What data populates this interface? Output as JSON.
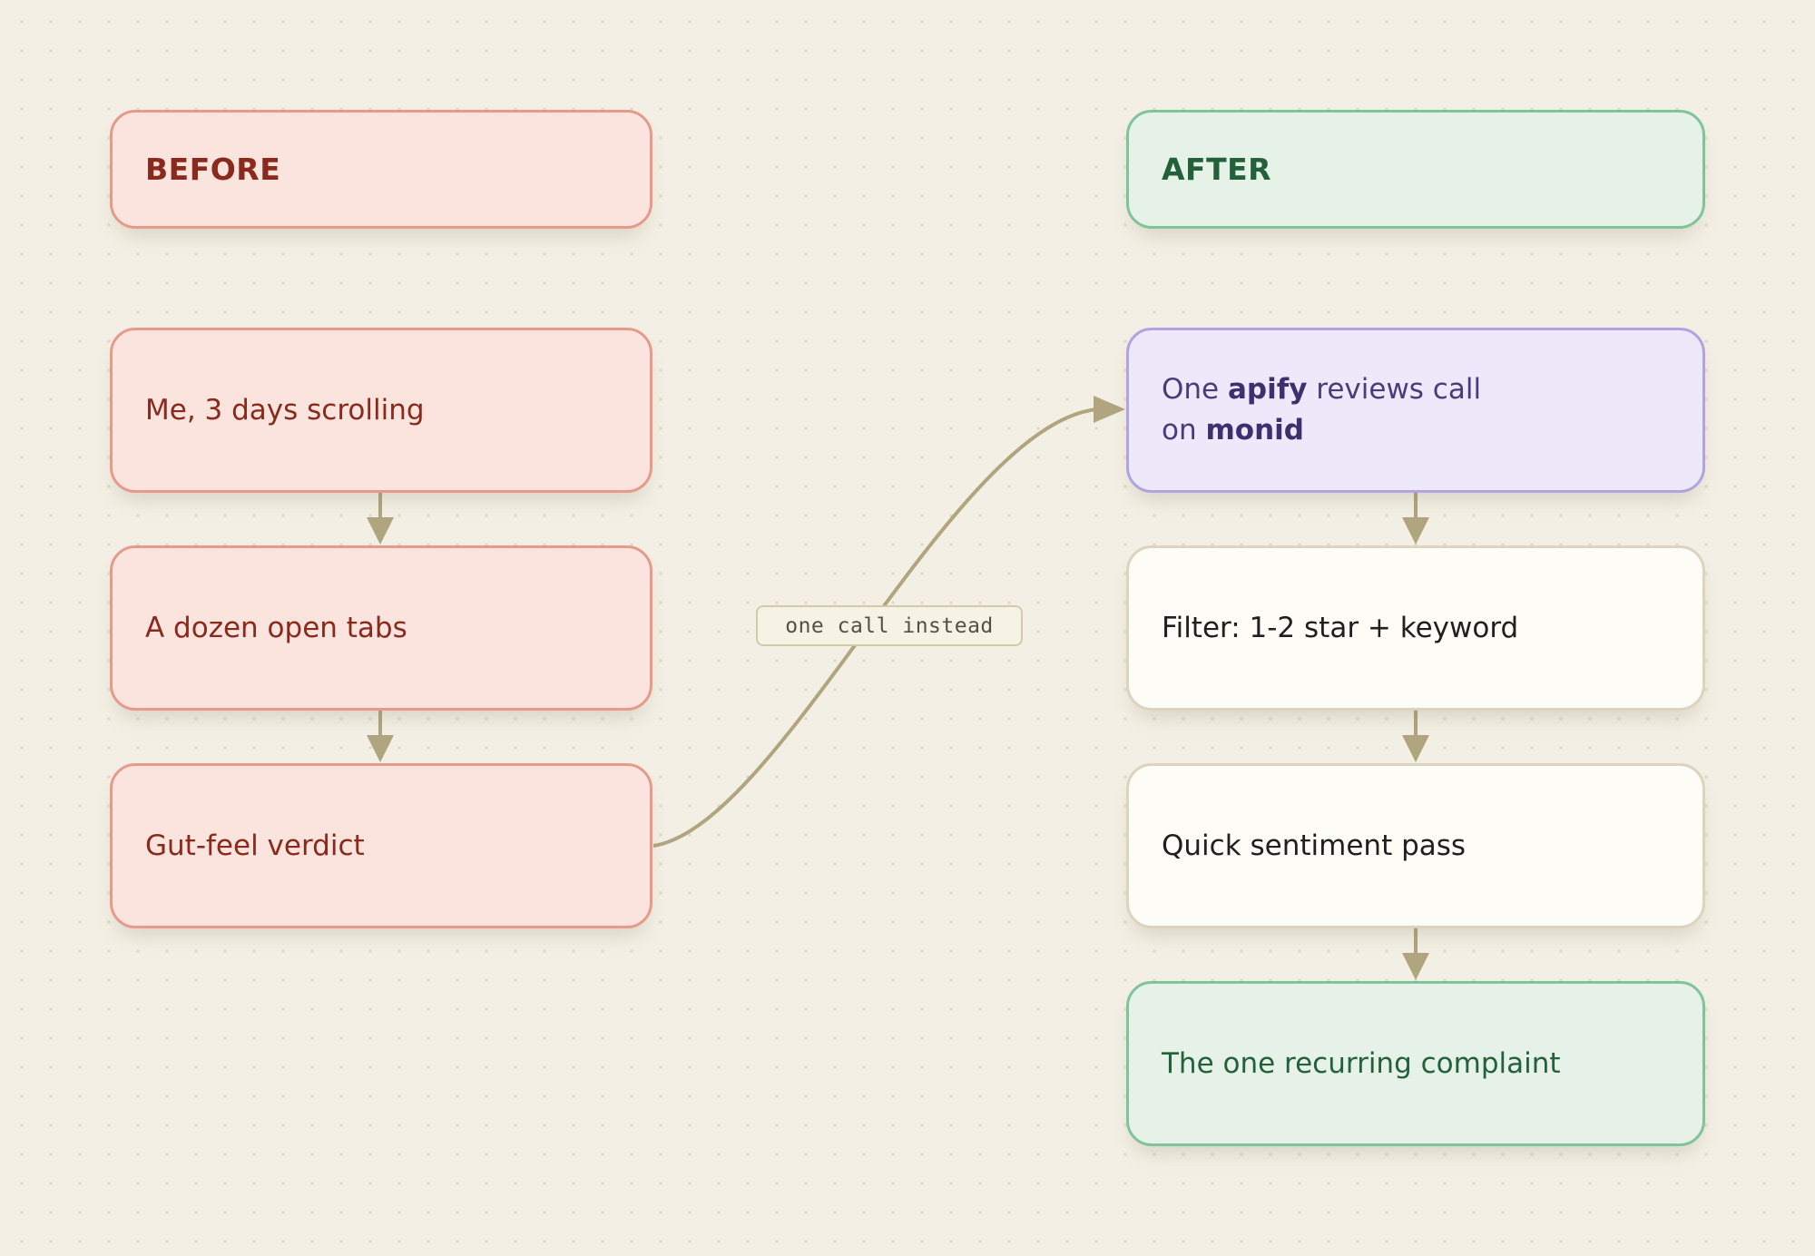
{
  "before": {
    "title": "BEFORE",
    "steps": [
      "Me, 3 days scrolling",
      "A dozen open tabs",
      "Gut-feel verdict"
    ]
  },
  "after": {
    "title": "AFTER",
    "first_step": {
      "pre": "One ",
      "tool": "apify",
      "mid": " reviews call",
      "line2_pre": "on ",
      "target": "monid"
    },
    "steps": [
      "Filter: 1-2 star + keyword",
      "Quick sentiment pass",
      "The one recurring complaint"
    ]
  },
  "connector_label": "one call instead",
  "colors": {
    "background": "#f3efe4",
    "arrow": "#b0a57f",
    "before_fill": "#fbe3de",
    "before_text": "#8a2a1c",
    "after_fill": "#e6f2e8",
    "after_text": "#22613a",
    "highlight_fill": "#ede8fa",
    "neutral_fill": "#fdfcf6"
  }
}
